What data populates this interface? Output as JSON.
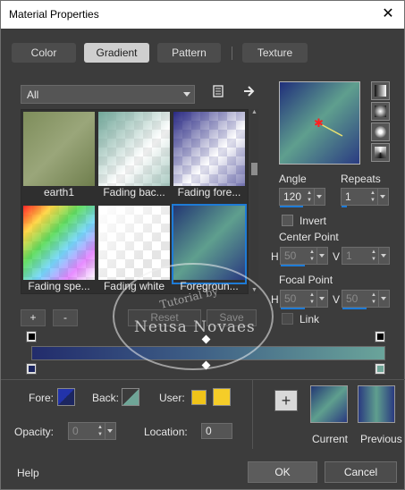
{
  "window": {
    "title": "Material Properties",
    "close_glyph": "✕"
  },
  "tabs": [
    {
      "label": "Color",
      "active": false
    },
    {
      "label": "Gradient",
      "active": true
    },
    {
      "label": "Pattern",
      "active": false
    },
    {
      "label": "Texture",
      "active": false
    }
  ],
  "category": {
    "selected": "All"
  },
  "swatches": [
    {
      "label": "earth1",
      "selected": false
    },
    {
      "label": "Fading bac...",
      "selected": false
    },
    {
      "label": "Fading fore...",
      "selected": false
    },
    {
      "label": "Fading spe...",
      "selected": false
    },
    {
      "label": "Fading white",
      "selected": false
    },
    {
      "label": "Foregroun...",
      "selected": true
    }
  ],
  "list_buttons": {
    "add": "+",
    "remove": "-",
    "reset": "Reset",
    "save": "Save"
  },
  "angle": {
    "label": "Angle",
    "value": "120"
  },
  "repeats": {
    "label": "Repeats",
    "value": "1"
  },
  "invert": {
    "label": "Invert",
    "checked": false
  },
  "center_point": {
    "label": "Center Point",
    "h_label": "H",
    "h_value": "50",
    "v_label": "V",
    "v_value": "1"
  },
  "focal_point": {
    "label": "Focal Point",
    "h_label": "H",
    "h_value": "50",
    "v_label": "V",
    "v_value": "50"
  },
  "link": {
    "label": "Link",
    "checked": false
  },
  "colors": {
    "fore": "#1c2660",
    "back": "#6fa597",
    "user_a": "#f0c419",
    "user_b": "#f5cd28",
    "accent": "#1e7bd6"
  },
  "bottom": {
    "fore_label": "Fore:",
    "back_label": "Back:",
    "user_label": "User:",
    "opacity_label": "Opacity:",
    "opacity_value": "0",
    "location_label": "Location:",
    "location_value": "0",
    "add_glyph": "+",
    "current_label": "Current",
    "previous_label": "Previous"
  },
  "footer": {
    "help": "Help",
    "ok": "OK",
    "cancel": "Cancel"
  },
  "watermark": {
    "line1": "Tutorial by",
    "line2": "Neusa Novaes"
  }
}
